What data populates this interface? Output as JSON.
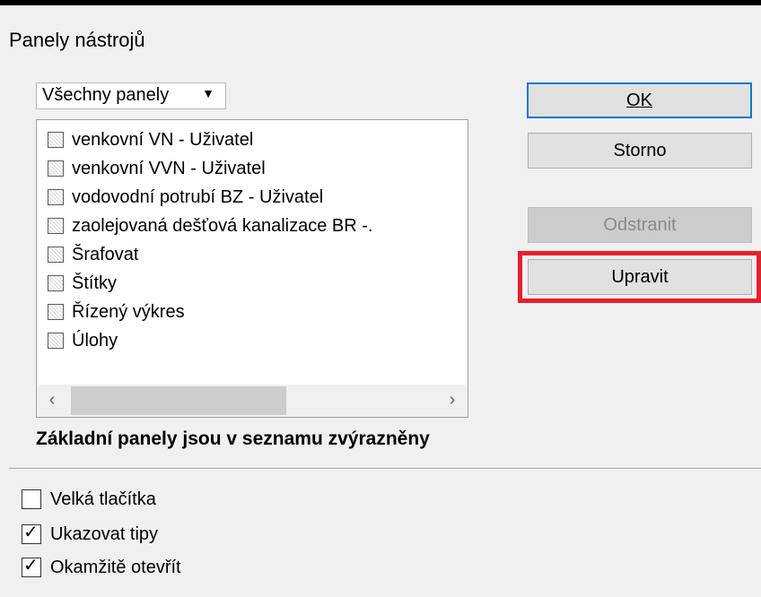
{
  "dialog": {
    "title": "Panely nástrojů"
  },
  "filter": {
    "selected": "Všechny panely"
  },
  "toolbars": [
    "venkovní VN - Uživatel",
    "venkovní VVN - Uživatel",
    "vodovodní potrubí BZ - Uživatel",
    "zaolejovaná dešťová kanalizace BR -.",
    "Šrafovat",
    "Štítky",
    "Řízený výkres",
    "Úlohy"
  ],
  "buttons": {
    "ok": "OK",
    "cancel": "Storno",
    "delete": "Odstranit",
    "edit": "Upravit"
  },
  "note": "Základní panely jsou v seznamu zvýrazněny",
  "options": [
    {
      "label": "Velká tlačítka",
      "checked": false
    },
    {
      "label": "Ukazovat tipy",
      "checked": true
    },
    {
      "label": "Okamžitě otevřít",
      "checked": true
    }
  ],
  "colors": {
    "highlight": "#e8202a",
    "default_button_border": "#0078d7"
  }
}
